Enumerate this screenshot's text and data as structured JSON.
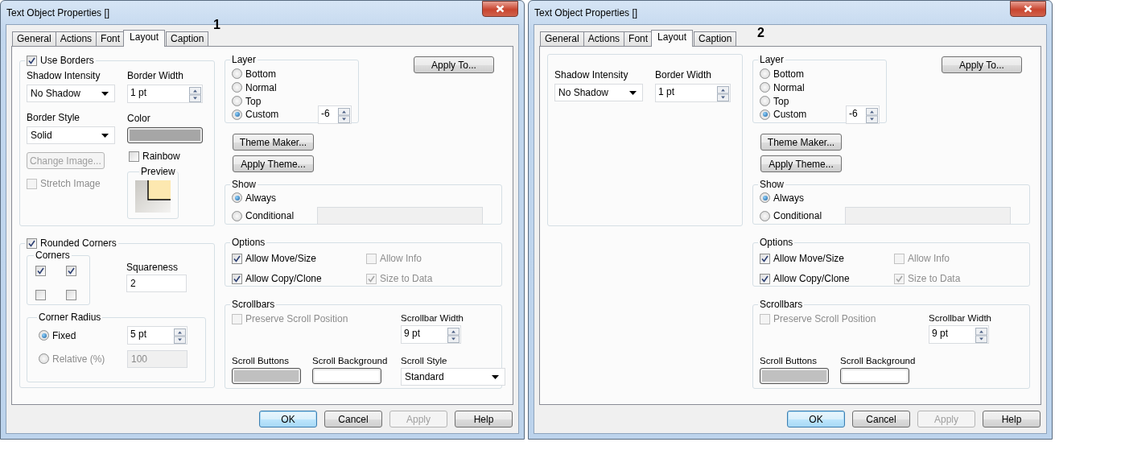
{
  "dialogs": [
    {
      "title": "Text Object Properties []",
      "annotation": "1",
      "tabs": [
        {
          "label": "General",
          "selected": false
        },
        {
          "label": "Actions",
          "selected": false
        },
        {
          "label": "Font",
          "selected": false
        },
        {
          "label": "Layout",
          "selected": true
        },
        {
          "label": "Caption",
          "selected": false
        }
      ],
      "borders": {
        "use_borders": {
          "label": "Use Borders",
          "checked": true
        },
        "shadow_intensity": {
          "label": "Shadow Intensity",
          "value": "No Shadow"
        },
        "border_width": {
          "label": "Border Width",
          "value": "1 pt"
        },
        "border_style": {
          "label": "Border Style",
          "value": "Solid"
        },
        "color": {
          "label": "Color"
        },
        "change_image": {
          "label": "Change Image...",
          "disabled": true
        },
        "rainbow": {
          "label": "Rainbow",
          "checked": false,
          "disabled": false
        },
        "stretch_image": {
          "label": "Stretch Image",
          "checked": false,
          "disabled": true
        },
        "preview": {
          "label": "Preview"
        }
      },
      "rounded": {
        "rounded_corners": {
          "label": "Rounded Corners",
          "checked": true
        },
        "corners": {
          "label": "Corners",
          "items": [
            {
              "checked": true
            },
            {
              "checked": true
            },
            {
              "checked": false
            },
            {
              "checked": false
            }
          ]
        },
        "squareness": {
          "label": "Squareness",
          "value": "2"
        },
        "corner_radius": {
          "label": "Corner Radius",
          "fixed": {
            "label": "Fixed",
            "selected": true,
            "value": "5 pt"
          },
          "relative": {
            "label": "Relative (%)",
            "selected": false,
            "value": "100",
            "disabled": true
          }
        }
      },
      "layer": {
        "label": "Layer",
        "options": [
          {
            "label": "Bottom",
            "selected": false
          },
          {
            "label": "Normal",
            "selected": false
          },
          {
            "label": "Top",
            "selected": false
          },
          {
            "label": "Custom",
            "selected": true
          }
        ],
        "custom_value": "-6"
      },
      "apply_to": "Apply To...",
      "theme_maker": "Theme Maker...",
      "apply_theme": "Apply Theme...",
      "show": {
        "label": "Show",
        "options": [
          {
            "label": "Always",
            "selected": true
          },
          {
            "label": "Conditional",
            "selected": false
          }
        ],
        "conditional_field": {
          "disabled": true
        }
      },
      "options": {
        "label": "Options",
        "items": [
          {
            "label": "Allow Move/Size",
            "checked": true,
            "disabled": false
          },
          {
            "label": "Allow Info",
            "checked": false,
            "disabled": true
          },
          {
            "label": "Allow Copy/Clone",
            "checked": true,
            "disabled": false
          },
          {
            "label": "Size to Data",
            "checked": true,
            "disabled": true
          }
        ]
      },
      "scrollbars": {
        "label": "Scrollbars",
        "preserve": {
          "label": "Preserve Scroll Position",
          "checked": false,
          "disabled": true
        },
        "width": {
          "label": "Scrollbar Width",
          "value": "9 pt"
        },
        "scroll_buttons": {
          "label": "Scroll Buttons"
        },
        "scroll_background": {
          "label": "Scroll Background"
        },
        "scroll_style": {
          "label": "Scroll Style",
          "value": "Standard"
        }
      },
      "buttons": [
        {
          "label": "OK",
          "default": true,
          "disabled": false
        },
        {
          "label": "Cancel",
          "default": false,
          "disabled": false
        },
        {
          "label": "Apply",
          "default": false,
          "disabled": true
        },
        {
          "label": "Help",
          "default": false,
          "disabled": false
        }
      ]
    },
    {
      "title": "Text Object Properties []",
      "annotation": "2",
      "tabs": [
        {
          "label": "General",
          "selected": false
        },
        {
          "label": "Actions",
          "selected": false
        },
        {
          "label": "Font",
          "selected": false
        },
        {
          "label": "Layout",
          "selected": true
        },
        {
          "label": "Caption",
          "selected": false
        }
      ],
      "borders": {
        "shadow_intensity": {
          "label": "Shadow Intensity",
          "value": "No Shadow"
        },
        "border_width": {
          "label": "Border Width",
          "value": "1 pt"
        }
      },
      "layer": {
        "label": "Layer",
        "options": [
          {
            "label": "Bottom",
            "selected": false
          },
          {
            "label": "Normal",
            "selected": false
          },
          {
            "label": "Top",
            "selected": false
          },
          {
            "label": "Custom",
            "selected": true
          }
        ],
        "custom_value": "-6"
      },
      "apply_to": "Apply To...",
      "theme_maker": "Theme Maker...",
      "apply_theme": "Apply Theme...",
      "show": {
        "label": "Show",
        "options": [
          {
            "label": "Always",
            "selected": true
          },
          {
            "label": "Conditional",
            "selected": false
          }
        ],
        "conditional_field": {
          "disabled": true
        }
      },
      "options": {
        "label": "Options",
        "items": [
          {
            "label": "Allow Move/Size",
            "checked": true,
            "disabled": false
          },
          {
            "label": "Allow Info",
            "checked": false,
            "disabled": true
          },
          {
            "label": "Allow Copy/Clone",
            "checked": true,
            "disabled": false
          },
          {
            "label": "Size to Data",
            "checked": true,
            "disabled": true
          }
        ]
      },
      "scrollbars": {
        "label": "Scrollbars",
        "preserve": {
          "label": "Preserve Scroll Position",
          "checked": false,
          "disabled": true
        },
        "width": {
          "label": "Scrollbar Width",
          "value": "9 pt"
        },
        "scroll_buttons": {
          "label": "Scroll Buttons"
        },
        "scroll_background": {
          "label": "Scroll Background"
        }
      },
      "buttons": [
        {
          "label": "OK",
          "default": true,
          "disabled": false
        },
        {
          "label": "Cancel",
          "default": false,
          "disabled": false
        },
        {
          "label": "Apply",
          "default": false,
          "disabled": true
        },
        {
          "label": "Help",
          "default": false,
          "disabled": false
        }
      ]
    }
  ]
}
